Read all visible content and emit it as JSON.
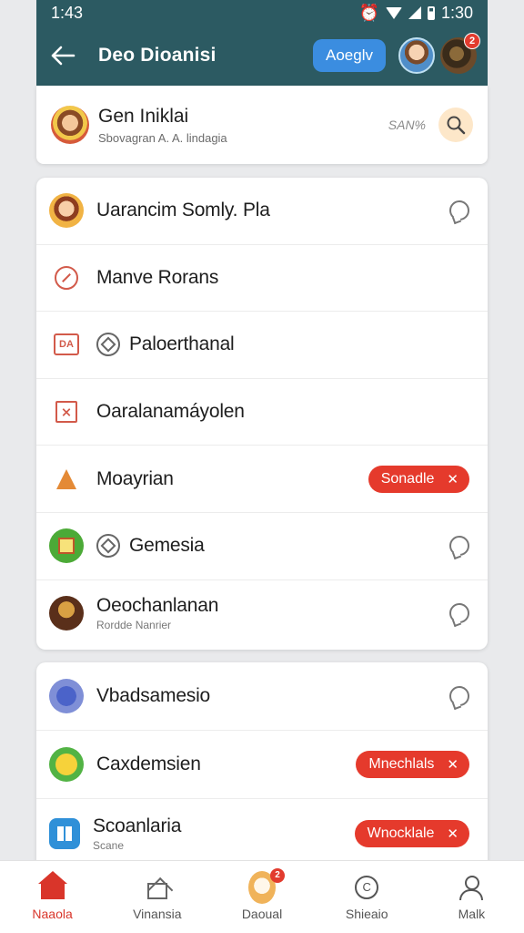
{
  "status_bar": {
    "left_time": "1:43",
    "right_time": "1:30"
  },
  "app_bar": {
    "title": "Deo Dioanisi",
    "action_button": "Aoeglv",
    "notification_count": "2"
  },
  "profile": {
    "name": "Gen Iniklai",
    "subtitle": "Sbovagran A. A. lindagia",
    "meta": "SAN%"
  },
  "list_one": [
    {
      "title": "Uarancim Somly. Pla",
      "trailing": "chat-icon"
    },
    {
      "title": "Manve Rorans",
      "trailing": ""
    },
    {
      "title": "Paloerthanal",
      "trailing": ""
    },
    {
      "title": "Oaralanamáyolen",
      "trailing": ""
    },
    {
      "title": "Moayrian",
      "trailing": "pill",
      "pill": "Sonadle"
    },
    {
      "title": "Gemesia",
      "trailing": "chat-icon"
    },
    {
      "title": "Oeochanlanan",
      "subtitle": "Rordde Nanrier",
      "trailing": "chat-icon"
    }
  ],
  "list_two": [
    {
      "title": "Vbadsamesio",
      "trailing": "chat-icon"
    },
    {
      "title": "Caxdemsien",
      "trailing": "pill",
      "pill": "Mnechlals"
    },
    {
      "title": "Scoanlaria",
      "subtitle": "Scane",
      "trailing": "pill",
      "pill": "Wnocklale"
    }
  ],
  "nav_icon_square_label": "DA",
  "nav": [
    {
      "label": "Naaola",
      "icon": "home-icon",
      "active": true
    },
    {
      "label": "Vinansia",
      "icon": "home-outline-icon"
    },
    {
      "label": "Daoual",
      "icon": "profile-center-icon",
      "badge": "2"
    },
    {
      "label": "Shieaio",
      "icon": "c-circle-icon"
    },
    {
      "label": "Malk",
      "icon": "person-icon"
    }
  ],
  "colors": {
    "header": "#2c5a62",
    "accent_red": "#e53a2c",
    "button_blue": "#3b8de0"
  }
}
